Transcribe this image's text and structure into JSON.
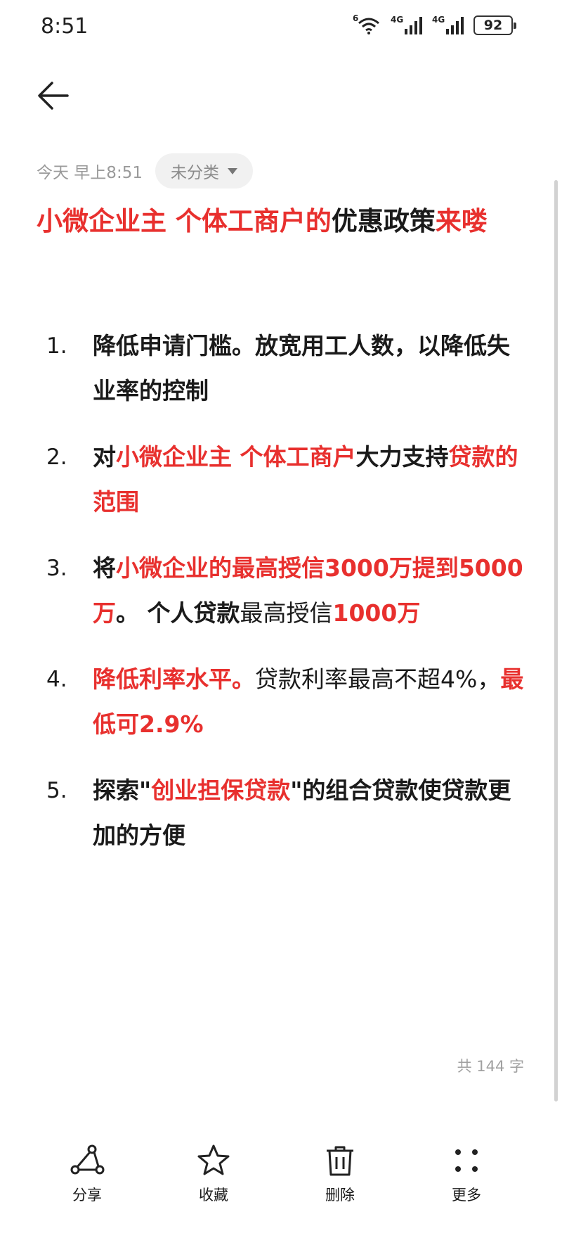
{
  "status": {
    "time": "8:51",
    "wifi_label": "6",
    "sig1_label": "4G",
    "sig2_label": "4G",
    "battery": "92"
  },
  "meta": {
    "date": "今天 早上8:51",
    "category": "未分类"
  },
  "title": {
    "part_red": "小微企业主  个体工商户的",
    "part_dark": "优惠政策",
    "part_red_end": "来喽"
  },
  "items": [
    {
      "num": "1.",
      "a": "降低申请门槛。放宽用工人数，以降低失业率的控制"
    },
    {
      "num": "2.",
      "a": "对",
      "b": "小微企业主 个体工商户",
      "c": "大力支持",
      "d": "贷款的范围"
    },
    {
      "num": "3.",
      "a": "将",
      "b": "小微企业的最高授信3000万提到5000万",
      "c": "。 个人贷款",
      "d": "最高授信",
      "e": "1000万"
    },
    {
      "num": "4.",
      "a": "降低利率水平。",
      "b": "贷款利率最高不超4%，",
      "c": "最低可2.9%"
    },
    {
      "num": "5.",
      "a": "探索\"",
      "b": "创业担保贷款",
      "c": "\"的组合贷款使贷款更加的方便"
    }
  ],
  "word_count": "共 144 字",
  "toolbar": {
    "share": "分享",
    "favorite": "收藏",
    "delete": "删除",
    "more": "更多"
  },
  "colors": {
    "accent_red": "#e8302e",
    "text_dark": "#1a1a1a",
    "muted": "#9a9a9a"
  }
}
